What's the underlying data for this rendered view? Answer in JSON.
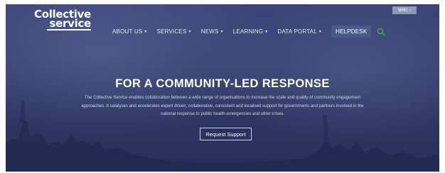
{
  "logo": {
    "line1": "Collective",
    "line2": "service"
  },
  "topbar": {
    "wiki_label": "WIKI"
  },
  "nav": {
    "items": [
      {
        "label": "ABOUT US",
        "has_dropdown": true
      },
      {
        "label": "SERVICES",
        "has_dropdown": true
      },
      {
        "label": "NEWS",
        "has_dropdown": true
      },
      {
        "label": "LEARNING",
        "has_dropdown": true
      },
      {
        "label": "DATA PORTAL",
        "has_dropdown": true
      }
    ],
    "helpdesk_label": "HELPDESK",
    "search_icon": "search-icon"
  },
  "hero": {
    "title": "FOR A COMMUNITY-LED RESPONSE",
    "description": "The Collective Service  enables collaboration between a wide range of organisations to increase the scale and quality of community engagement approaches. It catalyses and accelerates expert driven, collaborative, consistent and localised support for governments and partners involved in the national response to public health emergencies and other crises.",
    "button_label": "Request Support"
  },
  "colors": {
    "overlay": "#333c6d",
    "helpdesk_bg": "#4a5a8c",
    "search_icon": "#3fb05a",
    "wiki_bg": "#8f97b8"
  }
}
